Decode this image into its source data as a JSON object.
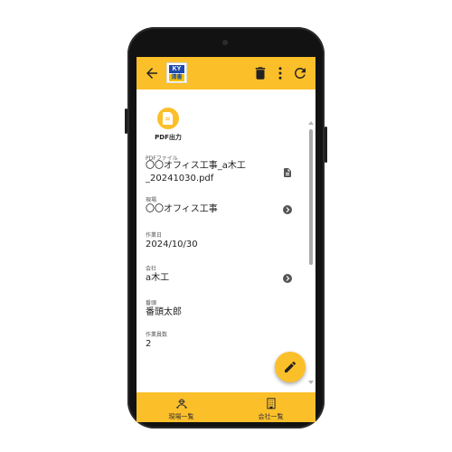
{
  "appbar": {
    "logo_top": "KY",
    "logo_bottom": "清書",
    "icons": [
      "back-arrow-icon",
      "trash-icon",
      "more-vert-icon",
      "refresh-icon"
    ]
  },
  "pdf_action": {
    "label": "PDF出力",
    "icon": "pdf-file-icon"
  },
  "fields": [
    {
      "label": "PDFファイル",
      "value_line1": "〇〇オフィス工事_a木工",
      "value_line2": "_20241030.pdf",
      "icon": "document-icon"
    },
    {
      "label": "現場",
      "value": "〇〇オフィス工事",
      "icon": "chevron-right-circle-icon"
    },
    {
      "label": "作業日",
      "value": "2024/10/30"
    },
    {
      "label": "会社",
      "value": "a木工",
      "icon": "chevron-right-circle-icon"
    },
    {
      "label": "番頭",
      "value": "番頭太郎"
    },
    {
      "label": "作業員数",
      "value": "2"
    }
  ],
  "fab": {
    "icon": "edit-icon"
  },
  "bottom_nav": [
    {
      "label": "現場一覧",
      "icon": "construction-worker-icon"
    },
    {
      "label": "会社一覧",
      "icon": "building-icon"
    }
  ],
  "colors": {
    "accent": "#FBBF2A",
    "text": "#222222"
  }
}
